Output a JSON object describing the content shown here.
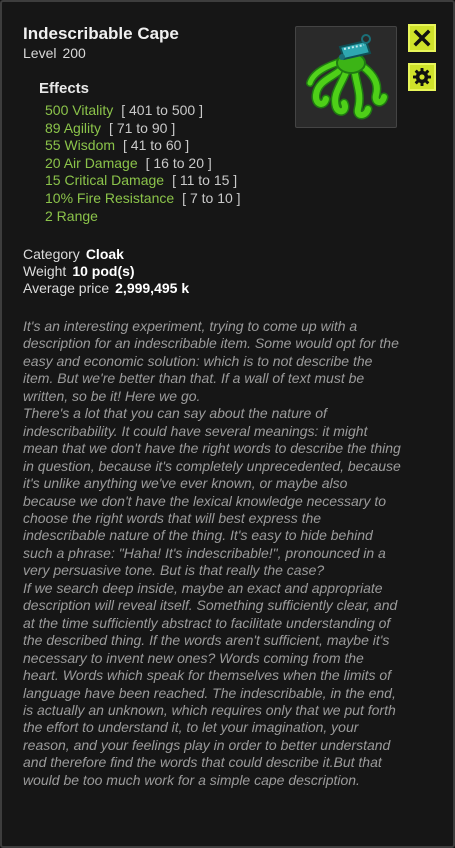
{
  "item": {
    "name": "Indescribable Cape",
    "level_label": "Level",
    "level_value": "200",
    "icon": "green-tentacle-cape-icon"
  },
  "actions": {
    "close_icon": "close-icon",
    "settings_icon": "gear-icon"
  },
  "effects": {
    "title": "Effects",
    "items": [
      {
        "text": "500 Vitality",
        "range": "[ 401 to 500 ]"
      },
      {
        "text": "89 Agility",
        "range": "[ 71 to 90 ]"
      },
      {
        "text": "55 Wisdom",
        "range": "[ 41 to 60 ]"
      },
      {
        "text": "20 Air Damage",
        "range": "[ 16 to 20 ]"
      },
      {
        "text": "15 Critical Damage",
        "range": "[ 11 to 15 ]"
      },
      {
        "text": "10% Fire Resistance",
        "range": "[ 7 to 10 ]"
      },
      {
        "text": "2 Range",
        "range": ""
      }
    ]
  },
  "info": {
    "category_label": "Category",
    "category_value": "Cloak",
    "weight_label": "Weight",
    "weight_value": "10 pod(s)",
    "price_label": "Average price",
    "price_value": "2,999,495 k"
  },
  "description": "It's an interesting experiment, trying to come up with a description for an indescribable item. Some would opt for the easy and economic solution: which is to not describe the item. But we're better than that. If a wall of text must be written, so be it! Here we go.\nThere's a lot that you can say about the nature of indescribability. It could have several meanings: it might mean that we don't have the right words to describe the thing in question, because it's completely unprecedented, because it's unlike anything we've ever known, or maybe also because we don't have the lexical knowledge necessary to choose the right words that will best express the indescribable nature of the thing. It's easy to hide behind such a phrase: \"Haha! It's indescribable!\", pronounced in a very persuasive tone. But is that really the case?\nIf we search deep inside, maybe an exact and appropriate description will reveal itself. Something sufficiently clear, and at the time sufficiently abstract to facilitate understanding of the described thing. If the words aren't sufficient, maybe it's necessary to invent new ones? Words coming from the heart. Words which speak for themselves when the limits of language have been reached. The indescribable, in the end, is actually an unknown, which requires only that we put forth the effort to understand it, to let your imagination, your reason, and your feelings play in order to better understand and therefore find the words that could describe it.But that would be too much work for a simple cape description.",
  "colors": {
    "panel": "#161616",
    "effect_green": "#8bc34a",
    "button_yellow": "#cfe22a",
    "description_gray": "#9b9b9b"
  }
}
